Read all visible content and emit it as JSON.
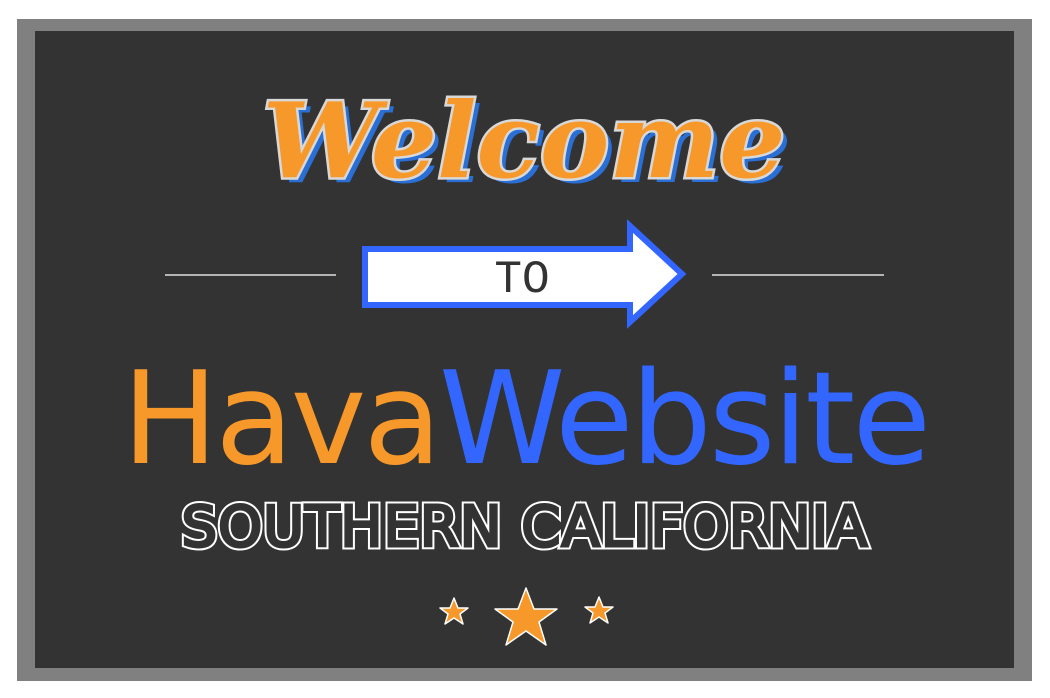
{
  "sign": {
    "headline": "Welcome",
    "arrow_label": "TO",
    "brand_part1": "Hava",
    "brand_part2": "Website",
    "region": "SOUTHERN CALIFORNIA"
  },
  "colors": {
    "orange": "#f7982a",
    "blue": "#3366ff",
    "board": "#333333",
    "frame": "#808080"
  }
}
